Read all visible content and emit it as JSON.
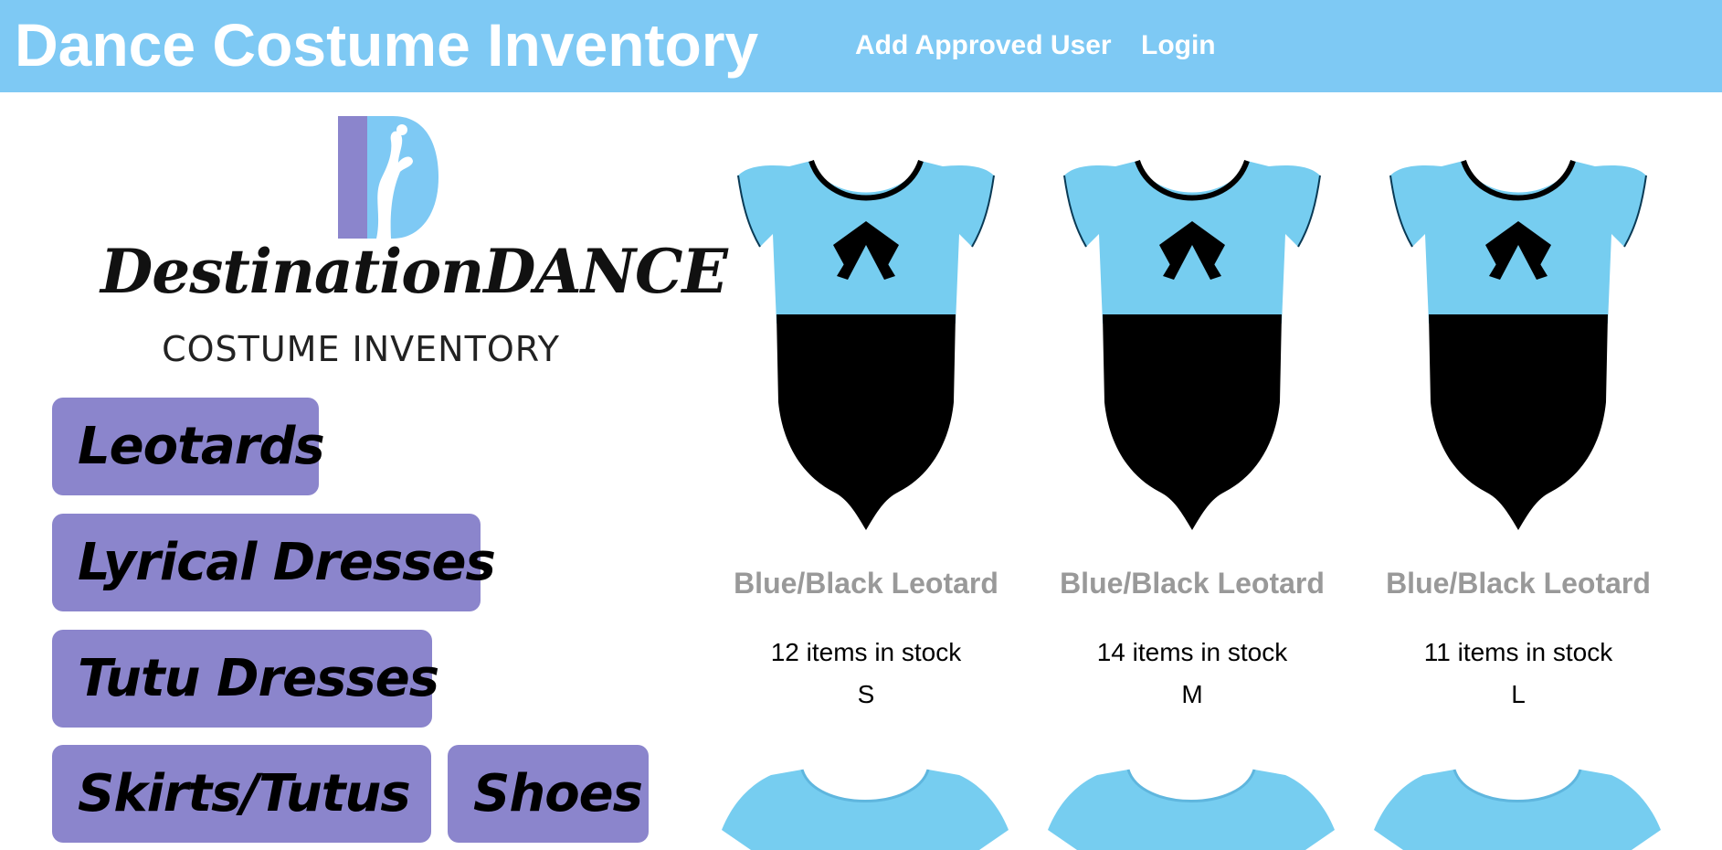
{
  "header": {
    "title": "Dance Costume Inventory",
    "nav": [
      {
        "label": "Add Approved User"
      },
      {
        "label": "Login"
      }
    ]
  },
  "logo": {
    "wordmark": "DestinationDANCE",
    "subtitle": "COSTUME INVENTORY"
  },
  "categories": [
    {
      "label": "Leotards"
    },
    {
      "label": "Lyrical Dresses"
    },
    {
      "label": "Tutu Dresses"
    },
    {
      "label": "Skirts/Tutus"
    },
    {
      "label": "Shoes"
    }
  ],
  "products": [
    {
      "name": "Blue/Black Leotard",
      "stock": "12 items in stock",
      "size": "S"
    },
    {
      "name": "Blue/Black Leotard",
      "stock": "14 items in stock",
      "size": "M"
    },
    {
      "name": "Blue/Black Leotard",
      "stock": "11 items in stock",
      "size": "L"
    }
  ],
  "colors": {
    "header_bg": "#7ec9f4",
    "category_button_bg": "#8b85cc",
    "leotard_blue": "#76cdf0",
    "leotard_black": "#000000",
    "product_name": "#999999"
  }
}
